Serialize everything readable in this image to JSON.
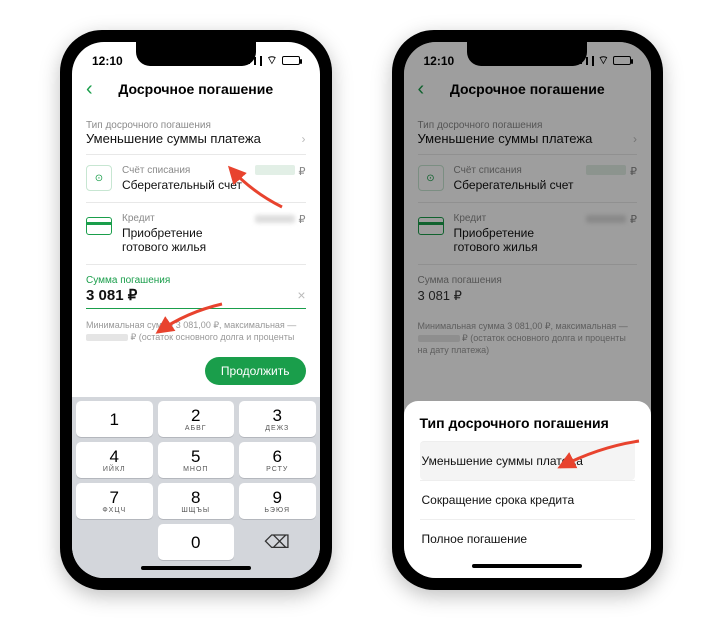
{
  "status": {
    "time": "12:10"
  },
  "nav": {
    "title": "Досрочное погашение"
  },
  "typeRow": {
    "label": "Тип досрочного погашения",
    "value": "Уменьшение суммы платежа"
  },
  "account": {
    "label": "Счёт списания",
    "name": "Сберегательный счет",
    "currency": "₽"
  },
  "credit": {
    "label": "Кредит",
    "name": "Приобретение готового жилья",
    "currency": "₽"
  },
  "amount": {
    "label": "Сумма погашения",
    "value": "3 081 ₽",
    "valuePlain": "3 081 ₽"
  },
  "hint": {
    "line1a": "Минимальная сумма 3 081,00 ₽, максимальная —",
    "line1b": "₽ (остаток основного долга и проценты",
    "extra": "на дату платежа)"
  },
  "cta": "Продолжить",
  "keys": [
    {
      "n": "1",
      "s": ""
    },
    {
      "n": "2",
      "s": "АБВГ"
    },
    {
      "n": "3",
      "s": "ДЕЖЗ"
    },
    {
      "n": "4",
      "s": "ИЙКЛ"
    },
    {
      "n": "5",
      "s": "МНОП"
    },
    {
      "n": "6",
      "s": "РСТУ"
    },
    {
      "n": "7",
      "s": "ФХЦЧ"
    },
    {
      "n": "8",
      "s": "ШЩЪЫ"
    },
    {
      "n": "9",
      "s": "ЬЭЮЯ"
    },
    {
      "n": "",
      "s": ""
    },
    {
      "n": "0",
      "s": ""
    },
    {
      "n": "⌫",
      "s": ""
    }
  ],
  "sheet": {
    "title": "Тип досрочного погашения",
    "options": [
      "Уменьшение суммы платежа",
      "Сокращение срока кредита",
      "Полное погашение"
    ]
  }
}
